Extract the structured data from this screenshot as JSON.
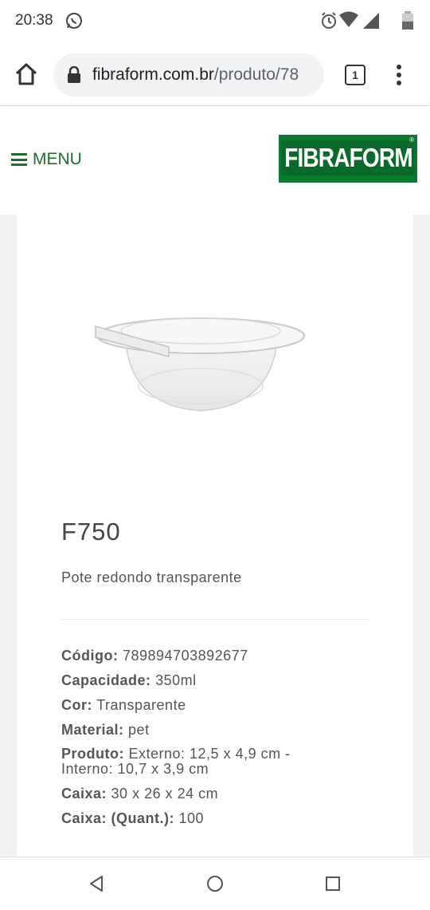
{
  "status_bar": {
    "time": "20:38",
    "icons": [
      "whatsapp-icon",
      "alarm-icon",
      "wifi-icon",
      "cell-signal-icon",
      "battery-icon"
    ]
  },
  "browser": {
    "url_domain": "fibraform.com.br",
    "url_path": "/produto/78",
    "tab_count": "1"
  },
  "header": {
    "menu_label": "MENU",
    "logo_text": "FIBRAFORM",
    "logo_mark": "®"
  },
  "product": {
    "title": "F750",
    "description": "Pote redondo transparente",
    "specs": [
      {
        "key": "Código:",
        "value": "789894703892677"
      },
      {
        "key": "Capacidade:",
        "value": "350ml"
      },
      {
        "key": "Cor:",
        "value": "Transparente"
      },
      {
        "key": "Material:",
        "value": "pet"
      },
      {
        "key": "Produto:",
        "value": "Externo: 12,5 x 4,9 cm - Interno: 10,7 x 3,9 cm"
      },
      {
        "key": "Caixa:",
        "value": "30 x 26 x 24 cm"
      },
      {
        "key": "Caixa: (Quant.):",
        "value": "100"
      }
    ]
  },
  "colors": {
    "brand_green": "#1f6e2e",
    "logo_green": "#0a6a2a"
  }
}
